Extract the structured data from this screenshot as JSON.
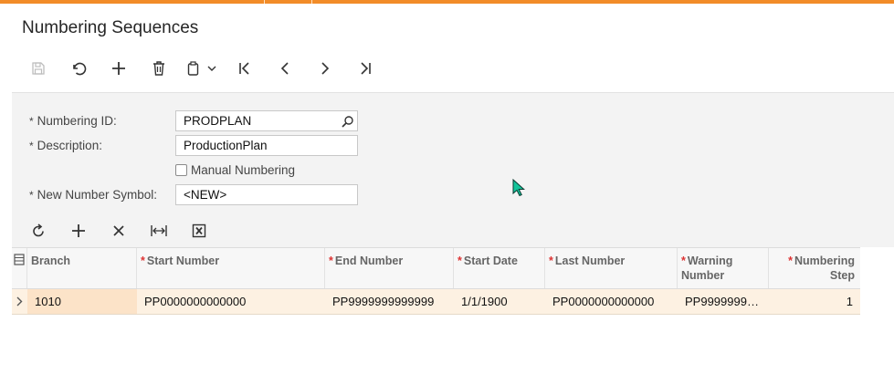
{
  "page": {
    "title": "Numbering Sequences"
  },
  "toolbar": {
    "icons": [
      "save-icon",
      "undo-icon",
      "add-icon",
      "delete-icon",
      "copy-paste-icon",
      "first-record-icon",
      "previous-record-icon",
      "next-record-icon",
      "last-record-icon"
    ]
  },
  "form": {
    "numbering_id": {
      "label": "Numbering ID:",
      "value": "PRODPLAN"
    },
    "description": {
      "label": "Description:",
      "value": "ProductionPlan"
    },
    "manual_numbering": {
      "label": "Manual Numbering",
      "checked": false
    },
    "new_number_symbol": {
      "label": "New Number Symbol:",
      "value": "<NEW>"
    }
  },
  "grid": {
    "toolbar_icons": [
      "refresh-icon",
      "add-row-icon",
      "delete-row-icon",
      "fit-width-icon",
      "export-excel-icon"
    ],
    "columns": {
      "branch": "Branch",
      "start_number": "Start Number",
      "end_number": "End Number",
      "start_date": "Start Date",
      "last_number": "Last Number",
      "warning_number": "Warning Number",
      "numbering_step": "Numbering Step"
    },
    "rows": [
      {
        "branch": "1010",
        "start_number": "PP0000000000000",
        "end_number": "PP9999999999999",
        "start_date": "1/1/1900",
        "last_number": "PP0000000000000",
        "warning_number": "PP9999999…",
        "numbering_step": "1"
      }
    ]
  },
  "colors": {
    "accent": "#f28c28",
    "selected_row": "#fdf1e2",
    "required_star": "#dd3333"
  }
}
